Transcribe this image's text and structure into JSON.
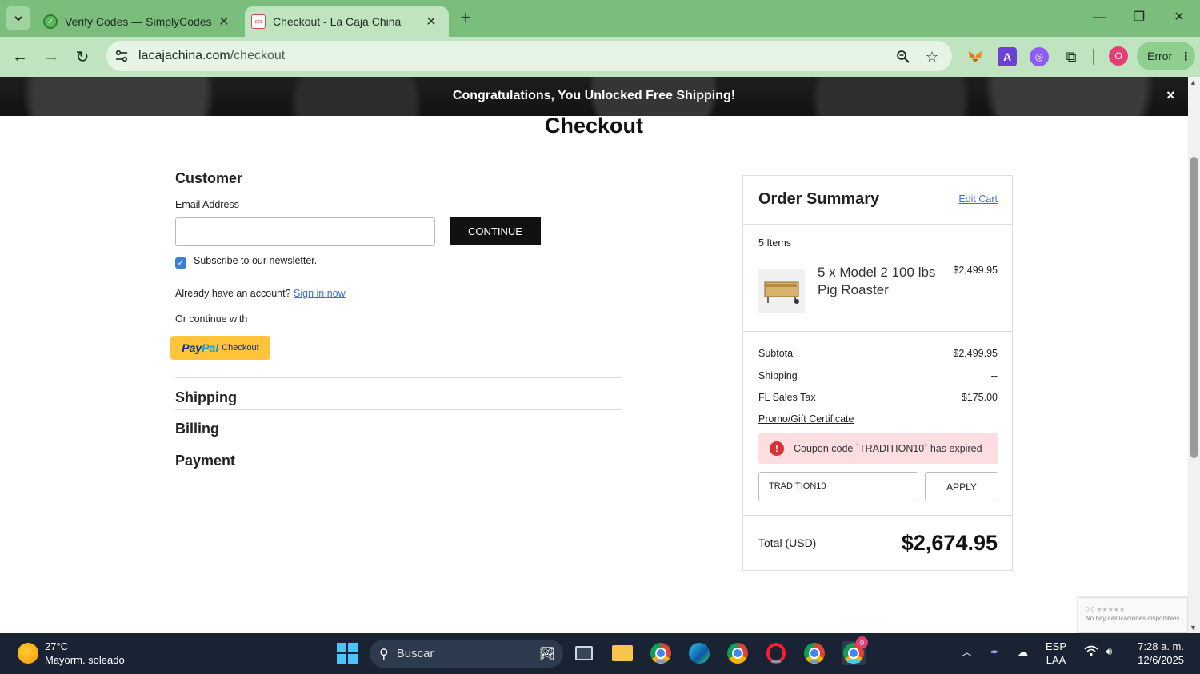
{
  "browser": {
    "tabs": [
      {
        "title": "Verify Codes — SimplyCodes",
        "active": false
      },
      {
        "title": "Checkout - La Caja China",
        "active": true
      }
    ],
    "url_domain": "lacajachina.com",
    "url_path": "/checkout",
    "profile_initial": "O",
    "error_label": "Error"
  },
  "banner": {
    "text": "Congratulations,  You Unlocked Free Shipping!",
    "close": "×"
  },
  "page": {
    "title": "Checkout"
  },
  "customer": {
    "heading": "Customer",
    "email_label": "Email Address",
    "email_value": "",
    "continue_label": "CONTINUE",
    "newsletter_label": "Subscribe to our newsletter.",
    "newsletter_checked": true,
    "account_text": "Already have an account?",
    "sign_in_label": "Sign in now",
    "or_continue": "Or continue with",
    "paypal_p1": "Pay",
    "paypal_p2": "Pal",
    "paypal_checkout": "Checkout"
  },
  "steps": {
    "shipping": "Shipping",
    "billing": "Billing",
    "payment": "Payment"
  },
  "summary": {
    "title": "Order Summary",
    "edit_cart": "Edit Cart",
    "items_count": "5 Items",
    "product_name": "5 x Model 2 100 lbs Pig Roaster",
    "product_price": "$2,499.95",
    "subtotal_label": "Subtotal",
    "subtotal_value": "$2,499.95",
    "shipping_label": "Shipping",
    "shipping_value": "--",
    "tax_label": "FL Sales Tax",
    "tax_value": "$175.00",
    "promo_label": "Promo/Gift Certificate",
    "coupon_error": "Coupon code `TRADITION10` has expired",
    "coupon_value": "TRADITION10",
    "apply_label": "APPLY",
    "total_label": "Total (USD)",
    "total_value": "$2,674.95"
  },
  "recaptcha": {
    "rating": "0.0 ★★★★★",
    "text": "No hay calificaciones disponibles"
  },
  "taskbar": {
    "temp": "27°C",
    "weather": "Mayorm. soleado",
    "search_placeholder": "Buscar",
    "chrome_badge": "0",
    "lang_top": "ESP",
    "lang_bottom": "LAA",
    "time": "7:28 a. m.",
    "date": "12/6/2025"
  },
  "colors": {
    "tabstrip": "#7bbd7b",
    "toolbar": "#bfe4bf",
    "link": "#3b6fd8",
    "paypal": "#ffc439",
    "alert_bg": "#fcdde0",
    "alert_icon": "#d93036"
  }
}
